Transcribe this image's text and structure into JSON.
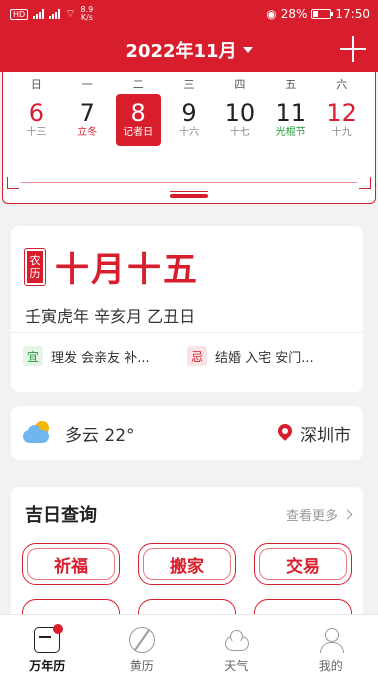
{
  "status": {
    "speed": "8.9",
    "speed_unit": "K/s",
    "battery": "28%",
    "time": "17:50"
  },
  "header": {
    "month_title": "2022年11月"
  },
  "week": {
    "weekdays": [
      "日",
      "一",
      "二",
      "三",
      "四",
      "五",
      "六"
    ],
    "days": [
      {
        "num": "6",
        "sub": "十三"
      },
      {
        "num": "7",
        "sub": "立冬"
      },
      {
        "num": "8",
        "sub": "记者日"
      },
      {
        "num": "9",
        "sub": "十六"
      },
      {
        "num": "10",
        "sub": "十七"
      },
      {
        "num": "11",
        "sub": "光棍节"
      },
      {
        "num": "12",
        "sub": "十九"
      }
    ]
  },
  "lunar": {
    "badge_top": "农",
    "badge_bottom": "历",
    "date": "十月十五",
    "ganzhi": "壬寅虎年  辛亥月  乙丑日",
    "yi_label": "宜",
    "yi_text": "理发 会亲友 补...",
    "ji_label": "忌",
    "ji_text": "结婚 入宅 安门..."
  },
  "weather": {
    "text": "多云  22°",
    "city": "深圳市"
  },
  "lucky": {
    "title": "吉日查询",
    "more": "查看更多",
    "items": [
      "祈福",
      "搬家",
      "交易"
    ]
  },
  "tabs": [
    "万年历",
    "黄历",
    "天气",
    "我的"
  ],
  "colors": {
    "accent": "#d81e2d",
    "good": "#2b9c3e"
  }
}
